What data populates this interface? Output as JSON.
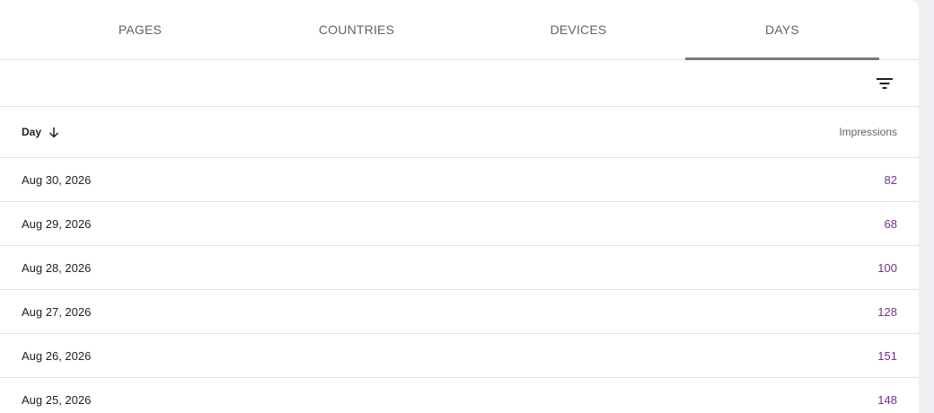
{
  "tabs": [
    {
      "label": "PAGES",
      "active": false
    },
    {
      "label": "COUNTRIES",
      "active": false
    },
    {
      "label": "DEVICES",
      "active": false
    },
    {
      "label": "DAYS",
      "active": true
    }
  ],
  "toolbar": {
    "filter_icon": "filter-list-icon"
  },
  "table": {
    "columns": {
      "day": "Day",
      "impressions": "Impressions"
    },
    "sort_icon": "arrow-down-icon",
    "rows": [
      {
        "day": "Aug 30, 2026",
        "impressions": "82"
      },
      {
        "day": "Aug 29, 2026",
        "impressions": "68"
      },
      {
        "day": "Aug 28, 2026",
        "impressions": "100"
      },
      {
        "day": "Aug 27, 2026",
        "impressions": "128"
      },
      {
        "day": "Aug 26, 2026",
        "impressions": "151"
      },
      {
        "day": "Aug 25, 2026",
        "impressions": "148"
      }
    ]
  },
  "colors": {
    "impressions_value": "#7b2a9c",
    "tab_underline": "#7a7a7a",
    "divider": "#e2e2e2",
    "background": "#eef0f4"
  }
}
